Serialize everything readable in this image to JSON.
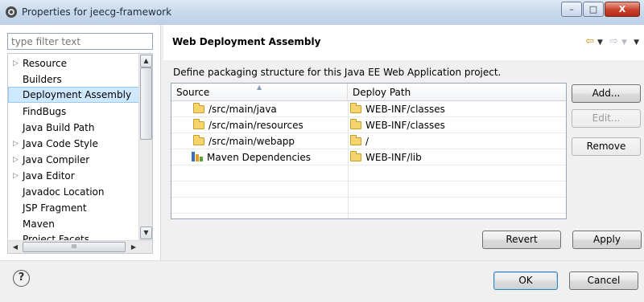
{
  "window": {
    "title": "Properties for jeecg-framework",
    "minimize_glyph": "–",
    "maximize_glyph": "□",
    "close_glyph": "X"
  },
  "sidebar": {
    "filter_placeholder": "type filter text",
    "items": [
      {
        "label": "Resource",
        "expandable": true
      },
      {
        "label": "Builders",
        "expandable": false
      },
      {
        "label": "Deployment Assembly",
        "expandable": false,
        "selected": true
      },
      {
        "label": "FindBugs",
        "expandable": false
      },
      {
        "label": "Java Build Path",
        "expandable": false
      },
      {
        "label": "Java Code Style",
        "expandable": true
      },
      {
        "label": "Java Compiler",
        "expandable": true
      },
      {
        "label": "Java Editor",
        "expandable": true
      },
      {
        "label": "Javadoc Location",
        "expandable": false
      },
      {
        "label": "JSP Fragment",
        "expandable": false
      },
      {
        "label": "Maven",
        "expandable": false
      },
      {
        "label": "Project Facets",
        "expandable": false
      }
    ],
    "scroll_thumb_glyph": "III"
  },
  "page": {
    "title": "Web Deployment Assembly",
    "description": "Define packaging structure for this Java EE Web Application project."
  },
  "table": {
    "columns": [
      "Source",
      "Deploy Path"
    ],
    "rows": [
      {
        "source": "/src/main/java",
        "deploy": "WEB-INF/classes",
        "icon": "folder-icon"
      },
      {
        "source": "/src/main/resources",
        "deploy": "WEB-INF/classes",
        "icon": "folder-icon"
      },
      {
        "source": "/src/main/webapp",
        "deploy": "/",
        "icon": "folder-icon"
      },
      {
        "source": "Maven Dependencies",
        "deploy": "WEB-INF/lib",
        "icon": "maven-library-icon"
      }
    ]
  },
  "buttons": {
    "add": "Add...",
    "edit": "Edit...",
    "remove": "Remove",
    "revert": "Revert",
    "apply": "Apply",
    "ok": "OK",
    "cancel": "Cancel"
  },
  "colors": {
    "selection": "#cde8ff",
    "nav_arrow_active": "#c78f00",
    "titlebar": "#c7d8ec",
    "close_button": "#c8412a"
  }
}
